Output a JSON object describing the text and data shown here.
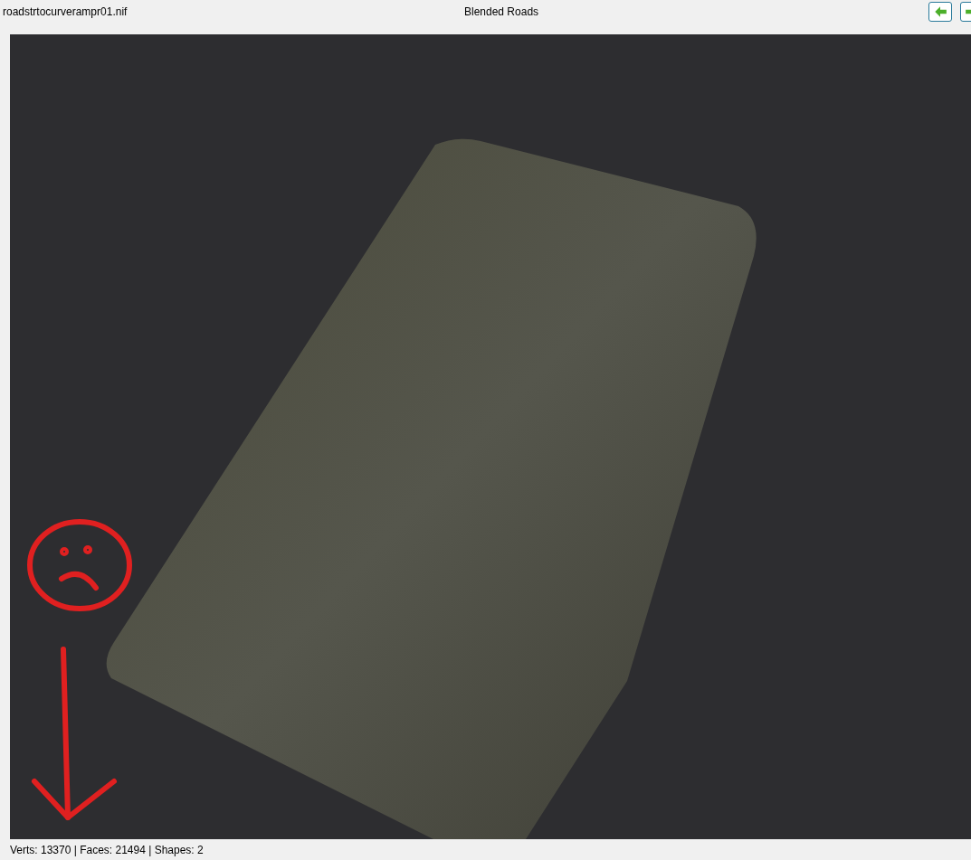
{
  "title_bar": {
    "file_name": "roadstrtocurverampr01.nif",
    "title": "Blended Roads"
  },
  "toolbar": {
    "buttons": [
      {
        "kind": "back"
      },
      {
        "kind": "forward"
      }
    ]
  },
  "status_bar": {
    "text": "Verts: 13370 | Faces: 21494 | Shapes: 2"
  }
}
